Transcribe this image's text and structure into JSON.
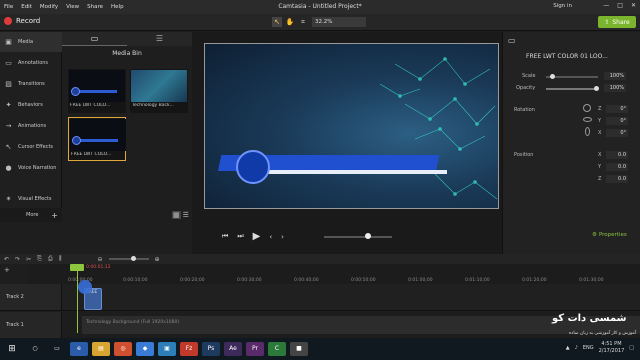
{
  "menu": [
    "File",
    "Edit",
    "Modify",
    "View",
    "Share",
    "Help"
  ],
  "window_title": "Camtasia - Untitled Project*",
  "sign_in": "Sign in",
  "win_controls": [
    "—",
    "□",
    "✕"
  ],
  "toolbar": {
    "record": "Record",
    "zoom": "32.2%",
    "share": "Share"
  },
  "sidebar": {
    "items": [
      "Media",
      "Annotations",
      "Transitions",
      "Behaviors",
      "Animations",
      "Cursor Effects",
      "Voice Narration",
      "Visual Effects"
    ],
    "more": "More"
  },
  "media_bin": {
    "title": "Media Bin",
    "clips": [
      {
        "label": "FREE LWT COLO..."
      },
      {
        "label": "Technology Back..."
      },
      {
        "label": "FREE LWT COLO..."
      }
    ]
  },
  "properties": {
    "title": "FREE LWT COLOR 01 LOO...",
    "scale_label": "Scale",
    "scale_value": "100%",
    "opacity_label": "Opacity",
    "opacity_value": "100%",
    "rotation_label": "Rotation",
    "rotation": [
      {
        "axis": "Z",
        "value": "0°"
      },
      {
        "axis": "Y",
        "value": "0°"
      },
      {
        "axis": "X",
        "value": "0°"
      }
    ],
    "position_label": "Position",
    "position": [
      {
        "axis": "X",
        "value": "0.0"
      },
      {
        "axis": "Y",
        "value": "0.0"
      },
      {
        "axis": "Z",
        "value": "0.0"
      }
    ],
    "button": "Properties"
  },
  "timeline": {
    "playhead_time": "0:00:01;12",
    "ticks": [
      "0:00:00;00",
      "0:00:10;00",
      "0:00:20;00",
      "0:00:30;00",
      "0:00:40;00",
      "0:00:50;00",
      "0:01:00;00",
      "0:01:10;00",
      "0:01:20;00",
      "0:01:30;00",
      "0:01:40;00"
    ],
    "tracks": [
      {
        "label": "Track 2",
        "clip": "FREE"
      },
      {
        "label": "Track 1",
        "clip": "Technology Background (Full 1920x1080)"
      }
    ]
  },
  "watermark": {
    "title": "شمسی دات کو",
    "subtitle": "آموزش و کار آموزشی به زبان ساده"
  },
  "taskbar": {
    "lang": "ENG",
    "time": "4:51 PM",
    "date": "2/17/2017"
  },
  "colors": {
    "accent_green": "#8ec63f",
    "record_red": "#e23b3b",
    "share_green": "#7ab52d"
  }
}
